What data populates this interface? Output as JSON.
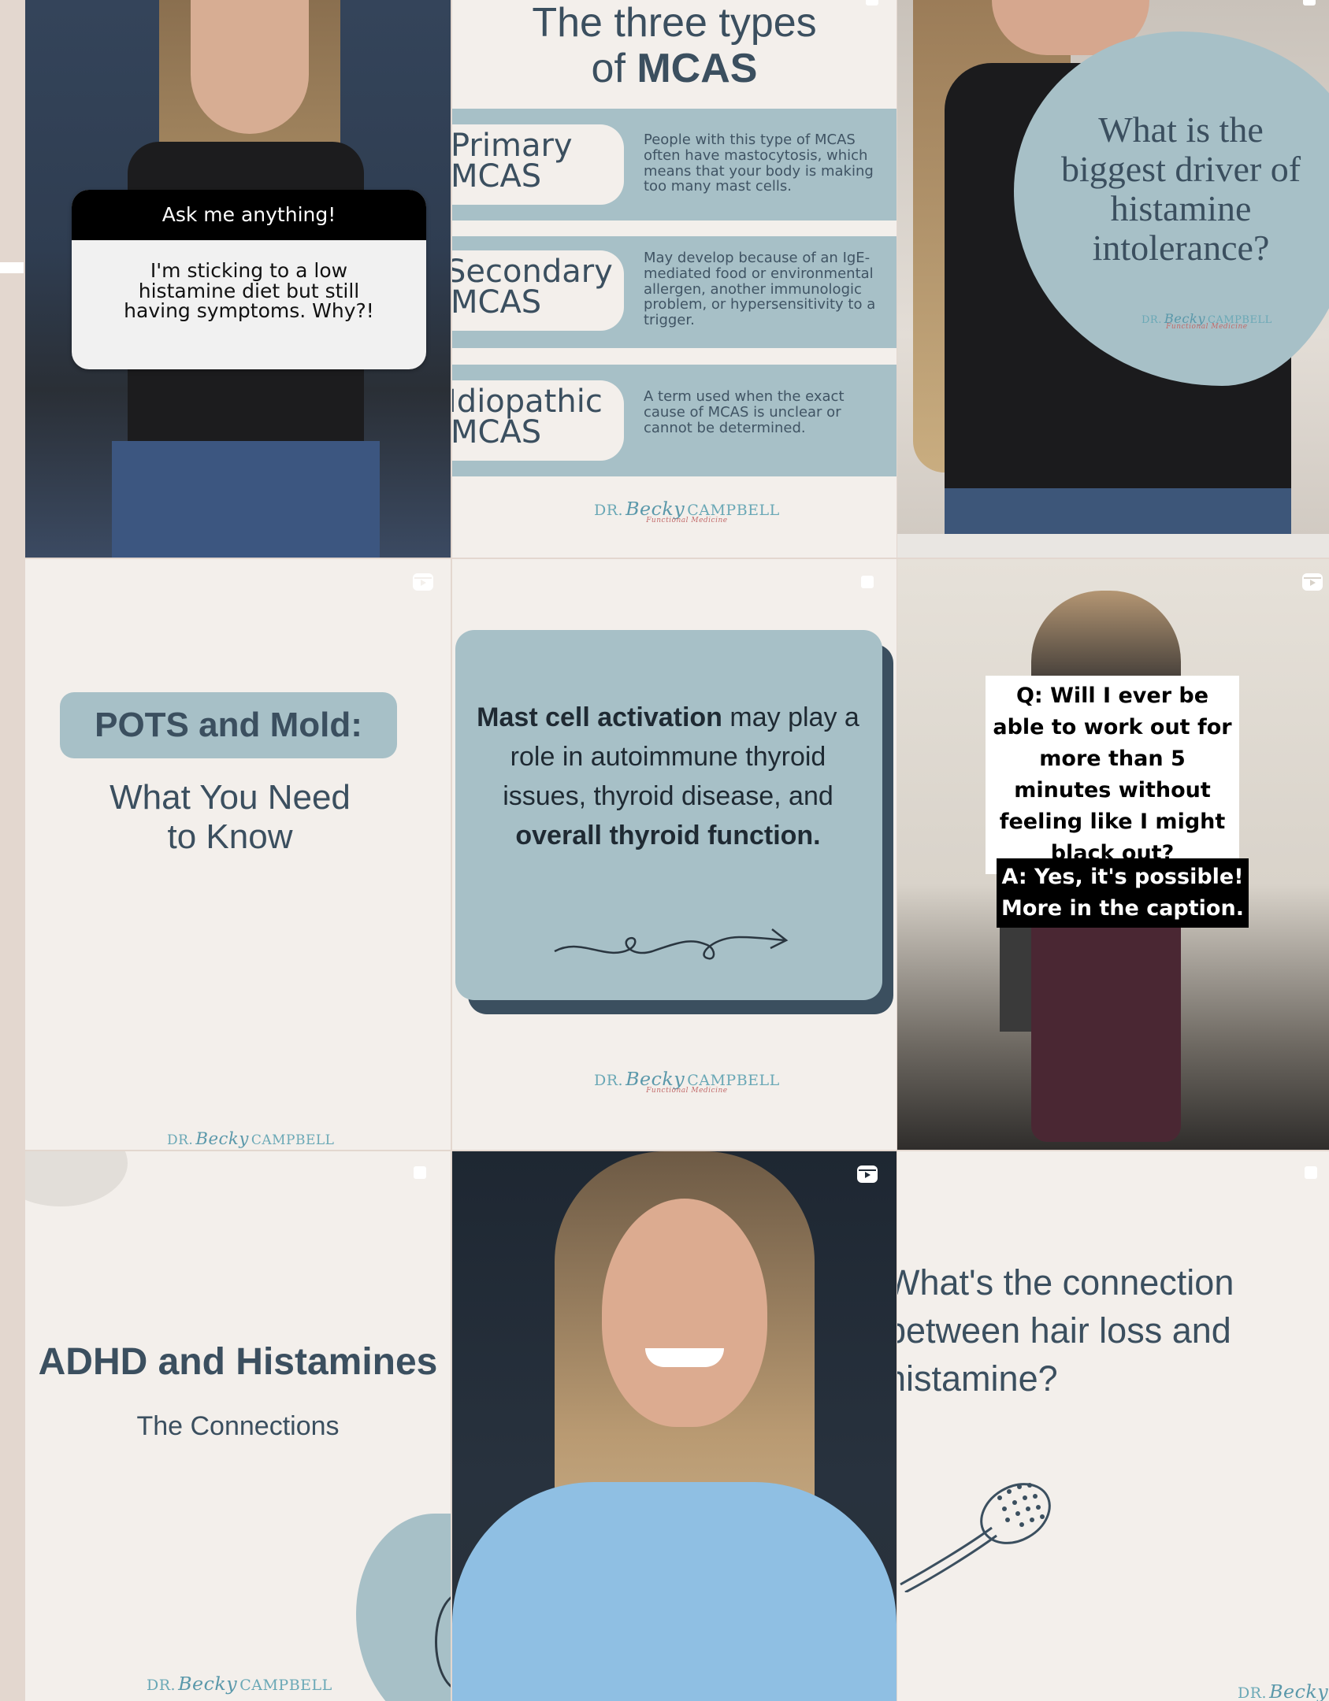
{
  "grid": {
    "tile1": {
      "question_header": "Ask me anything!",
      "question_text": "I'm sticking to a low histamine diet but still having symptoms. Why?!"
    },
    "tile2": {
      "title_line1": "The three types",
      "title_line2_prefix": "of ",
      "title_line2_bold": "MCAS",
      "types": [
        {
          "name_line1": "Primary",
          "name_line2": "MCAS",
          "desc": "People with this type of MCAS often have mastocytosis, which means that your body is making too many mast cells."
        },
        {
          "name_line1": "Secondary",
          "name_line2": "MCAS",
          "desc": "May develop because of an IgE-mediated food or environmental allergen, another immunologic problem, or hypersensitivity to a trigger."
        },
        {
          "name_line1": "Idiopathic",
          "name_line2": "MCAS",
          "desc": "A term used when the exact cause of MCAS is unclear or cannot be determined."
        }
      ]
    },
    "tile3": {
      "question": "What is the biggest driver of histamine intolerance?"
    },
    "tile4": {
      "title": "POTS and Mold:",
      "subtitle": "What You Need to Know"
    },
    "tile5": {
      "text_a": "Mast cell activation",
      "text_b": " may play a role in autoimmune thyroid issues, thyroid disease, and ",
      "text_c": "overall thyroid function."
    },
    "tile6": {
      "question": "Q: Will I ever be able to work out for more than 5 minutes without feeling like I might black out?",
      "answer": "A: Yes, it's possible! More in the caption."
    },
    "tile7": {
      "title": "ADHD and Histamines",
      "subtitle": "The Connections"
    },
    "tile9": {
      "question": "What's the connection between hair loss and histamine?"
    }
  },
  "logo": {
    "dr": "DR.",
    "first": "Becky",
    "last": "CAMPBELL",
    "tagline": "Functional Medicine"
  },
  "icons": {
    "reel": "reel-icon",
    "carousel": "carousel-icon",
    "arrow": "squiggle-arrow-icon",
    "hairbrush": "hairbrush-icon"
  },
  "colors": {
    "cream": "#f3efeb",
    "blue": "#a7c0c7",
    "ink": "#3b4f5f",
    "accent_teal": "#6aa8b6"
  }
}
